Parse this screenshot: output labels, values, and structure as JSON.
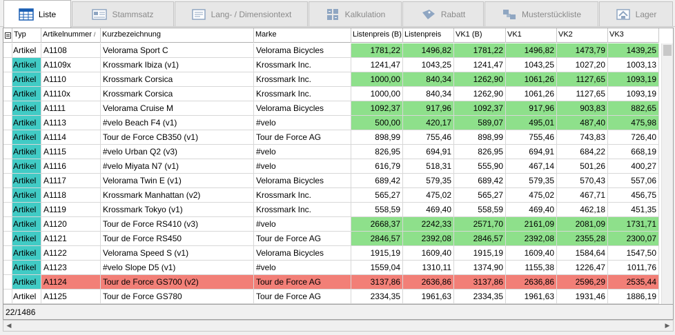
{
  "tabs": [
    {
      "label": "Liste",
      "icon": "table-icon",
      "active": true
    },
    {
      "label": "Stammsatz",
      "icon": "record-card-icon",
      "active": false
    },
    {
      "label": "Lang- / Dimensiontext",
      "icon": "text-document-icon",
      "active": false
    },
    {
      "label": "Kalkulation",
      "icon": "calculator-icon",
      "active": false
    },
    {
      "label": "Rabatt",
      "icon": "discount-tag-icon",
      "active": false
    },
    {
      "label": "Musterstückliste",
      "icon": "parts-list-icon",
      "active": false
    },
    {
      "label": "Lager",
      "icon": "warehouse-icon",
      "active": false
    }
  ],
  "grid": {
    "columns": [
      "Typ",
      "Artikelnummer",
      "Kurzbezeichnung",
      "Marke",
      "Listenpreis (B)",
      "Listenpreis",
      "VK1 (B)",
      "VK1",
      "VK2",
      "VK3"
    ],
    "sort_column": "Artikelnummer",
    "sort_indicator": "/",
    "rows": [
      {
        "typ": "Artikel",
        "nr": "A1108",
        "bez": "Velorama Sport C",
        "marke": "Velorama Bicycles",
        "lpb": "1781,22",
        "lp": "1496,82",
        "vk1b": "1781,22",
        "vk1": "1496,82",
        "vk2": "1473,79",
        "vk3": "1439,25",
        "status": "green",
        "teal": false
      },
      {
        "typ": "Artikel",
        "nr": "A1109x",
        "bez": "Krossmark Ibiza (v1)",
        "marke": "Krossmark Inc.",
        "lpb": "1241,47",
        "lp": "1043,25",
        "vk1b": "1241,47",
        "vk1": "1043,25",
        "vk2": "1027,20",
        "vk3": "1003,13",
        "status": "none",
        "teal": true
      },
      {
        "typ": "Artikel",
        "nr": "A1110",
        "bez": "Krossmark Corsica",
        "marke": "Krossmark Inc.",
        "lpb": "1000,00",
        "lp": "840,34",
        "vk1b": "1262,90",
        "vk1": "1061,26",
        "vk2": "1127,65",
        "vk3": "1093,19",
        "status": "green",
        "teal": true
      },
      {
        "typ": "Artikel",
        "nr": "A1110x",
        "bez": "Krossmark Corsica",
        "marke": "Krossmark Inc.",
        "lpb": "1000,00",
        "lp": "840,34",
        "vk1b": "1262,90",
        "vk1": "1061,26",
        "vk2": "1127,65",
        "vk3": "1093,19",
        "status": "none",
        "teal": true
      },
      {
        "typ": "Artikel",
        "nr": "A1111",
        "bez": "Velorama Cruise M",
        "marke": "Velorama Bicycles",
        "lpb": "1092,37",
        "lp": "917,96",
        "vk1b": "1092,37",
        "vk1": "917,96",
        "vk2": "903,83",
        "vk3": "882,65",
        "status": "green",
        "teal": true
      },
      {
        "typ": "Artikel",
        "nr": "A1113",
        "bez": "#velo Beach F4 (v1)",
        "marke": "#velo",
        "lpb": "500,00",
        "lp": "420,17",
        "vk1b": "589,07",
        "vk1": "495,01",
        "vk2": "487,40",
        "vk3": "475,98",
        "status": "green",
        "teal": true
      },
      {
        "typ": "Artikel",
        "nr": "A1114",
        "bez": "Tour de Force CB350 (v1)",
        "marke": "Tour de Force AG",
        "lpb": "898,99",
        "lp": "755,46",
        "vk1b": "898,99",
        "vk1": "755,46",
        "vk2": "743,83",
        "vk3": "726,40",
        "status": "none",
        "teal": true
      },
      {
        "typ": "Artikel",
        "nr": "A1115",
        "bez": "#velo Urban Q2 (v3)",
        "marke": "#velo",
        "lpb": "826,95",
        "lp": "694,91",
        "vk1b": "826,95",
        "vk1": "694,91",
        "vk2": "684,22",
        "vk3": "668,19",
        "status": "none",
        "teal": true
      },
      {
        "typ": "Artikel",
        "nr": "A1116",
        "bez": "#velo Miyata N7 (v1)",
        "marke": "#velo",
        "lpb": "616,79",
        "lp": "518,31",
        "vk1b": "555,90",
        "vk1": "467,14",
        "vk2": "501,26",
        "vk3": "400,27",
        "status": "none",
        "teal": true
      },
      {
        "typ": "Artikel",
        "nr": "A1117",
        "bez": "Velorama Twin E (v1)",
        "marke": "Velorama Bicycles",
        "lpb": "689,42",
        "lp": "579,35",
        "vk1b": "689,42",
        "vk1": "579,35",
        "vk2": "570,43",
        "vk3": "557,06",
        "status": "none",
        "teal": true
      },
      {
        "typ": "Artikel",
        "nr": "A1118",
        "bez": "Krossmark Manhattan (v2)",
        "marke": "Krossmark Inc.",
        "lpb": "565,27",
        "lp": "475,02",
        "vk1b": "565,27",
        "vk1": "475,02",
        "vk2": "467,71",
        "vk3": "456,75",
        "status": "none",
        "teal": true
      },
      {
        "typ": "Artikel",
        "nr": "A1119",
        "bez": "Krossmark Tokyo (v1)",
        "marke": "Krossmark Inc.",
        "lpb": "558,59",
        "lp": "469,40",
        "vk1b": "558,59",
        "vk1": "469,40",
        "vk2": "462,18",
        "vk3": "451,35",
        "status": "none",
        "teal": true
      },
      {
        "typ": "Artikel",
        "nr": "A1120",
        "bez": "Tour de Force RS410 (v3)",
        "marke": "#velo",
        "lpb": "2668,37",
        "lp": "2242,33",
        "vk1b": "2571,70",
        "vk1": "2161,09",
        "vk2": "2081,09",
        "vk3": "1731,71",
        "status": "green",
        "teal": true
      },
      {
        "typ": "Artikel",
        "nr": "A1121",
        "bez": "Tour de Force RS450",
        "marke": "Tour de Force AG",
        "lpb": "2846,57",
        "lp": "2392,08",
        "vk1b": "2846,57",
        "vk1": "2392,08",
        "vk2": "2355,28",
        "vk3": "2300,07",
        "status": "green",
        "teal": true
      },
      {
        "typ": "Artikel",
        "nr": "A1122",
        "bez": "Velorama Speed S (v1)",
        "marke": "Velorama Bicycles",
        "lpb": "1915,19",
        "lp": "1609,40",
        "vk1b": "1915,19",
        "vk1": "1609,40",
        "vk2": "1584,64",
        "vk3": "1547,50",
        "status": "none",
        "teal": true
      },
      {
        "typ": "Artikel",
        "nr": "A1123",
        "bez": "#velo Slope D5 (v1)",
        "marke": "#velo",
        "lpb": "1559,04",
        "lp": "1310,11",
        "vk1b": "1374,90",
        "vk1": "1155,38",
        "vk2": "1226,47",
        "vk3": "1011,76",
        "status": "none",
        "teal": true
      },
      {
        "typ": "Artikel",
        "nr": "A1124",
        "bez": "Tour de Force GS700 (v2)",
        "marke": "Tour de Force AG",
        "lpb": "3137,86",
        "lp": "2636,86",
        "vk1b": "3137,86",
        "vk1": "2636,86",
        "vk2": "2596,29",
        "vk3": "2535,44",
        "status": "red",
        "teal": true
      },
      {
        "typ": "Artikel",
        "nr": "A1125",
        "bez": "Tour de Force GS780",
        "marke": "Tour de Force AG",
        "lpb": "2334,35",
        "lp": "1961,63",
        "vk1b": "2334,35",
        "vk1": "1961,63",
        "vk2": "1931,46",
        "vk3": "1886,19",
        "status": "none",
        "teal": false
      }
    ]
  },
  "footer": {
    "record_counter": "22/1486"
  },
  "colors": {
    "green_row": "#8ee08b",
    "red_row": "#f27f77",
    "teal_type": "#41cbc5"
  }
}
